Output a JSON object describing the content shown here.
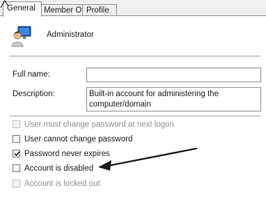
{
  "tabs": [
    {
      "label": "General"
    },
    {
      "label": "Member Of"
    },
    {
      "label": "Profile"
    }
  ],
  "user": {
    "name": "Administrator"
  },
  "form": {
    "full_name": {
      "label": "Full name:",
      "value": ""
    },
    "description": {
      "label": "Description:",
      "value": "Built-in account for administering the computer/domain"
    }
  },
  "options": [
    {
      "label": "User must change password at next logon",
      "checked": false,
      "enabled": false
    },
    {
      "label": "User cannot change password",
      "checked": false,
      "enabled": true
    },
    {
      "label": "Password never expires",
      "checked": true,
      "enabled": true
    },
    {
      "label": "Account is disabled",
      "checked": false,
      "enabled": true
    },
    {
      "label": "Account is locked out",
      "checked": false,
      "enabled": false
    }
  ],
  "colors": {
    "annotation_arrow": "#1a1a1a",
    "panel_border": "#898c95"
  }
}
